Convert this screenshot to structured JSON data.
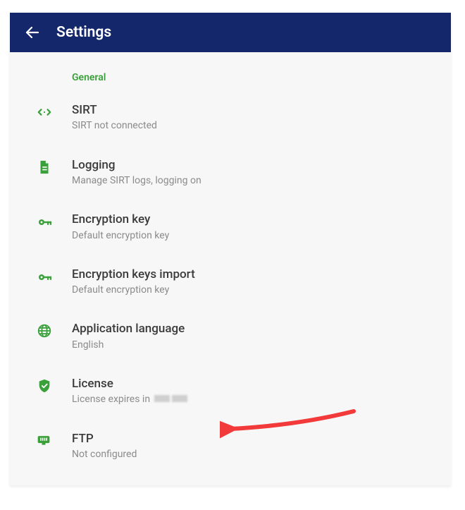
{
  "toolbar": {
    "title": "Settings"
  },
  "section": {
    "header": "General",
    "items": [
      {
        "icon": "data-transfer-icon",
        "title": "SIRT",
        "sub": "SIRT not connected"
      },
      {
        "icon": "document-icon",
        "title": "Logging",
        "sub": "Manage SIRT logs, logging on"
      },
      {
        "icon": "key-icon",
        "title": "Encryption key",
        "sub": "Default encryption key"
      },
      {
        "icon": "key-icon",
        "title": "Encryption keys import",
        "sub": "Default encryption key"
      },
      {
        "icon": "globe-icon",
        "title": "Application language",
        "sub": "English"
      },
      {
        "icon": "shield-check-icon",
        "title": "License",
        "sub": "License expires in ",
        "obscured": true
      },
      {
        "icon": "ethernet-icon",
        "title": "FTP",
        "sub": "Not configured"
      }
    ]
  },
  "colors": {
    "accent": "#3aa03a",
    "toolbar": "#15276b",
    "arrow": "#f23a3a"
  }
}
